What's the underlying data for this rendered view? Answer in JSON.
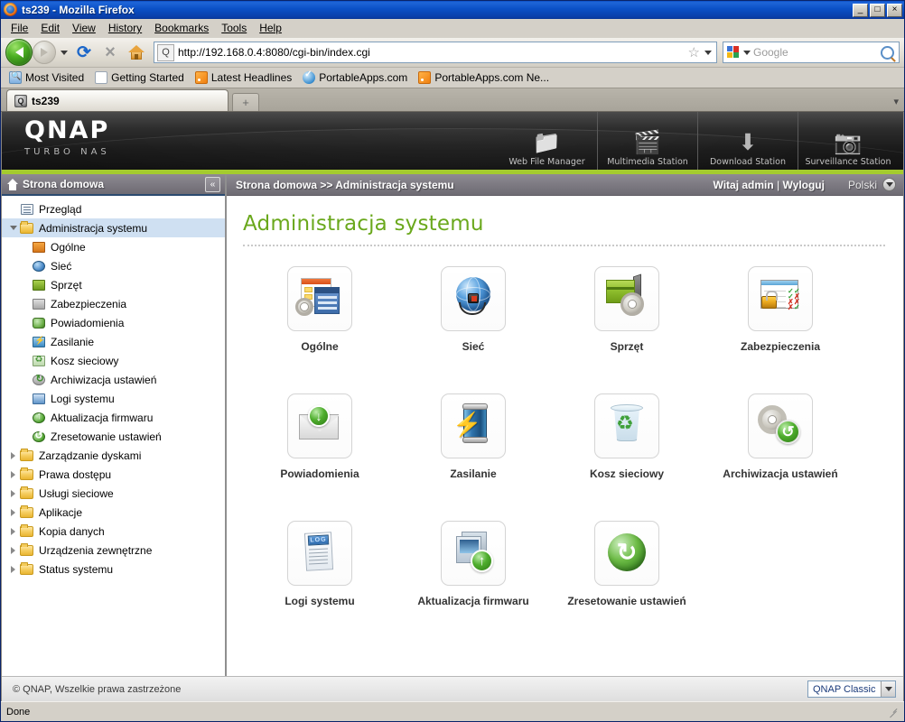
{
  "window": {
    "title": "ts239 - Mozilla Firefox",
    "minimize_label": "_",
    "maximize_label": "□",
    "close_label": "×"
  },
  "menubar": [
    {
      "label": "File"
    },
    {
      "label": "Edit"
    },
    {
      "label": "View"
    },
    {
      "label": "History"
    },
    {
      "label": "Bookmarks"
    },
    {
      "label": "Tools"
    },
    {
      "label": "Help"
    }
  ],
  "toolbar": {
    "back_tooltip": "Back",
    "forward_tooltip": "Forward",
    "reload_glyph": "⟳",
    "stop_glyph": "×",
    "home_tooltip": "Home",
    "url": "http://192.168.0.4:8080/cgi-bin/index.cgi",
    "bookmark_star": "☆",
    "search_placeholder": "Google"
  },
  "bookmarks": [
    {
      "label": "Most Visited",
      "icon": "most-visited-icon"
    },
    {
      "label": "Getting Started",
      "icon": "page-icon"
    },
    {
      "label": "Latest Headlines",
      "icon": "rss-icon"
    },
    {
      "label": "PortableApps.com",
      "icon": "check-icon"
    },
    {
      "label": "PortableApps.com Ne...",
      "icon": "rss-icon"
    }
  ],
  "tabs": {
    "active": {
      "label": "ts239"
    },
    "new_tab_label": "+",
    "list_all_label": "▾"
  },
  "banner": {
    "logo": "QNAP",
    "tagline": "TURBO NAS",
    "stations": [
      {
        "label": "Web File Manager",
        "icon": "📁",
        "icon_name": "web-file-manager-icon"
      },
      {
        "label": "Multimedia Station",
        "icon": "🎬",
        "icon_name": "multimedia-station-icon"
      },
      {
        "label": "Download Station",
        "icon": "⬇",
        "icon_name": "download-station-icon"
      },
      {
        "label": "Surveillance Station",
        "icon": "📷",
        "icon_name": "surveillance-station-icon"
      }
    ]
  },
  "sidebar": {
    "header": "Strona domowa",
    "collapse_label": "«",
    "items": [
      {
        "label": "Przegląd",
        "level": 1,
        "icon": "overview-icon",
        "twisty": "none",
        "selected": false
      },
      {
        "label": "Administracja systemu",
        "level": 1,
        "icon": "folder-icon",
        "twisty": "down",
        "selected": true
      },
      {
        "label": "Ogólne",
        "level": 2,
        "icon": "general-icon",
        "twisty": "none",
        "selected": false
      },
      {
        "label": "Sieć",
        "level": 2,
        "icon": "network-icon",
        "twisty": "none",
        "selected": false
      },
      {
        "label": "Sprzęt",
        "level": 2,
        "icon": "hardware-icon",
        "twisty": "none",
        "selected": false
      },
      {
        "label": "Zabezpieczenia",
        "level": 2,
        "icon": "security-icon",
        "twisty": "none",
        "selected": false
      },
      {
        "label": "Powiadomienia",
        "level": 2,
        "icon": "notification-icon",
        "twisty": "none",
        "selected": false
      },
      {
        "label": "Zasilanie",
        "level": 2,
        "icon": "power-icon",
        "twisty": "none",
        "selected": false
      },
      {
        "label": "Kosz sieciowy",
        "level": 2,
        "icon": "recycle-bin-icon",
        "twisty": "none",
        "selected": false
      },
      {
        "label": "Archiwizacja ustawień",
        "level": 2,
        "icon": "backup-icon",
        "twisty": "none",
        "selected": false
      },
      {
        "label": "Logi systemu",
        "level": 2,
        "icon": "logs-icon",
        "twisty": "none",
        "selected": false
      },
      {
        "label": "Aktualizacja firmwaru",
        "level": 2,
        "icon": "firmware-icon",
        "twisty": "none",
        "selected": false
      },
      {
        "label": "Zresetowanie ustawień",
        "level": 2,
        "icon": "reset-icon",
        "twisty": "none",
        "selected": false
      },
      {
        "label": "Zarządzanie dyskami",
        "level": 1,
        "icon": "folder-icon",
        "twisty": "right",
        "selected": false
      },
      {
        "label": "Prawa dostępu",
        "level": 1,
        "icon": "folder-icon",
        "twisty": "right",
        "selected": false
      },
      {
        "label": "Usługi sieciowe",
        "level": 1,
        "icon": "folder-icon",
        "twisty": "right",
        "selected": false
      },
      {
        "label": "Aplikacje",
        "level": 1,
        "icon": "folder-icon",
        "twisty": "right",
        "selected": false
      },
      {
        "label": "Kopia danych",
        "level": 1,
        "icon": "folder-icon",
        "twisty": "right",
        "selected": false
      },
      {
        "label": "Urządzenia zewnętrzne",
        "level": 1,
        "icon": "folder-icon",
        "twisty": "right",
        "selected": false
      },
      {
        "label": "Status systemu",
        "level": 1,
        "icon": "folder-icon",
        "twisty": "right",
        "selected": false
      }
    ]
  },
  "crumbbar": {
    "breadcrumb": "Strona domowa >> Administracja systemu",
    "greeting": "Witaj admin",
    "separator": "|",
    "logout": "Wyloguj",
    "language": "Polski"
  },
  "main": {
    "title": "Administracja systemu",
    "tiles": [
      {
        "label": "Ogólne",
        "icon": "general-settings-icon"
      },
      {
        "label": "Sieć",
        "icon": "network-icon"
      },
      {
        "label": "Sprzęt",
        "icon": "hardware-icon"
      },
      {
        "label": "Zabezpieczenia",
        "icon": "security-icon"
      },
      {
        "label": "Powiadomienia",
        "icon": "notification-icon"
      },
      {
        "label": "Zasilanie",
        "icon": "power-icon"
      },
      {
        "label": "Kosz sieciowy",
        "icon": "network-recycle-bin-icon"
      },
      {
        "label": "Archiwizacja ustawień",
        "icon": "backup-settings-icon"
      },
      {
        "label": "Logi systemu",
        "icon": "system-logs-icon"
      },
      {
        "label": "Aktualizacja firmwaru",
        "icon": "firmware-update-icon"
      },
      {
        "label": "Zresetowanie ustawień",
        "icon": "reset-settings-icon"
      }
    ]
  },
  "page_footer": {
    "copyright": "© QNAP, Wszelkie prawa zastrzeżone",
    "theme": "QNAP Classic"
  },
  "statusbar": {
    "text": "Done"
  },
  "colors": {
    "accent_green": "#a4cb2e",
    "title_green": "#6aa81c",
    "titlebar_blue": "#0b51c8",
    "chrome_gray": "#d4d0c8",
    "bar_gray": "#7d7a82"
  }
}
